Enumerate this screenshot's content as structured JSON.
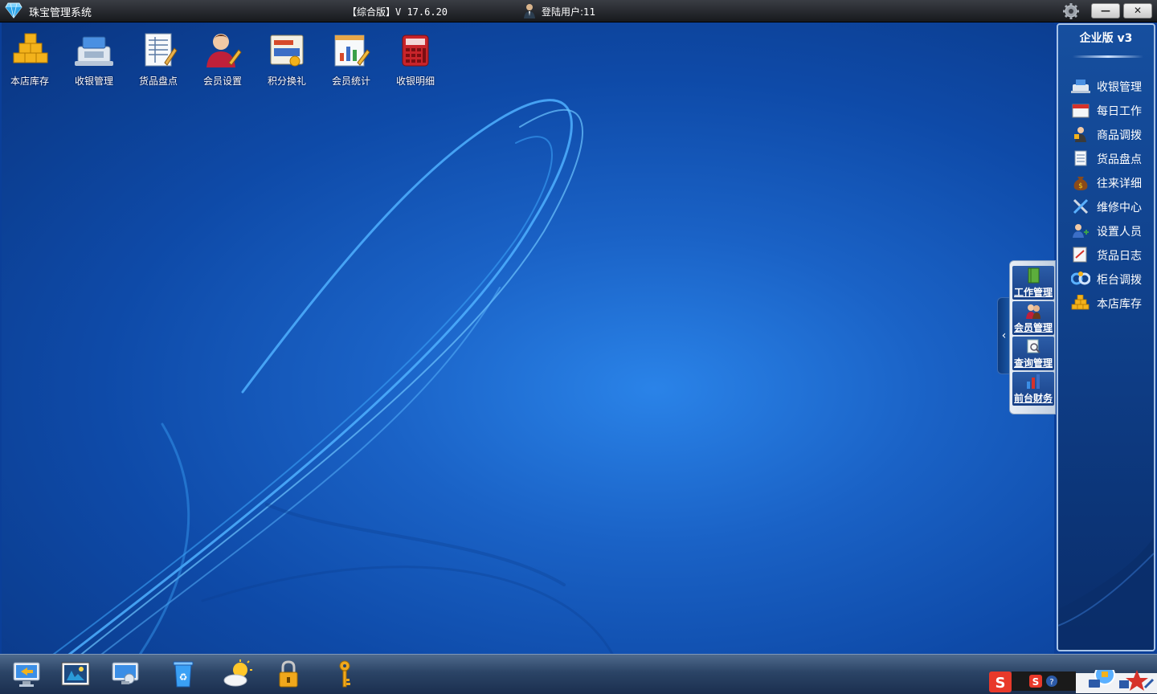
{
  "titlebar": {
    "app_title": "珠宝管理系统",
    "version": "【综合版】V 17.6.20",
    "login_user": "登陆用户:11",
    "minimize_label": "—",
    "close_label": "✕"
  },
  "desktop_icons": [
    {
      "label": "本店库存",
      "icon": "gold-coins-icon"
    },
    {
      "label": "收银管理",
      "icon": "cash-register-icon"
    },
    {
      "label": "货品盘点",
      "icon": "inventory-sheet-icon"
    },
    {
      "label": "会员设置",
      "icon": "member-user-icon"
    },
    {
      "label": "积分换礼",
      "icon": "points-gift-icon"
    },
    {
      "label": "会员统计",
      "icon": "member-stats-icon"
    },
    {
      "label": "收银明细",
      "icon": "calculator-icon"
    }
  ],
  "sidebar": {
    "edition": "企业版 v3",
    "items": [
      {
        "label": "收银管理",
        "icon": "cash-register-icon"
      },
      {
        "label": "每日工作",
        "icon": "calendar-icon"
      },
      {
        "label": "商品调拨",
        "icon": "transfer-icon"
      },
      {
        "label": "货品盘点",
        "icon": "inventory-sheet-icon"
      },
      {
        "label": "往来详细",
        "icon": "money-bag-icon"
      },
      {
        "label": "维修中心",
        "icon": "repair-tools-icon"
      },
      {
        "label": "设置人员",
        "icon": "add-user-icon"
      },
      {
        "label": "货品日志",
        "icon": "log-icon"
      },
      {
        "label": "柜台调拨",
        "icon": "counter-transfer-icon"
      },
      {
        "label": "本店库存",
        "icon": "gold-coins-icon"
      }
    ]
  },
  "side_tabs": [
    {
      "label": "工作管理",
      "icon": "notebook-icon"
    },
    {
      "label": "会员管理",
      "icon": "members-icon"
    },
    {
      "label": "查询管理",
      "icon": "query-icon"
    },
    {
      "label": "前台财务",
      "icon": "finance-chart-icon"
    }
  ],
  "taskbar_icons": [
    "monitor-back-icon",
    "picture-icon",
    "screen-icon",
    "recycle-bin-icon",
    "weather-icon",
    "lock-icon",
    "key-icon"
  ],
  "colors": {
    "desktop_center": "#2a83e8",
    "desktop_edge": "#0a3580",
    "sidebar_bg": "#164f9f",
    "titlebar_bg": "#17191d"
  }
}
